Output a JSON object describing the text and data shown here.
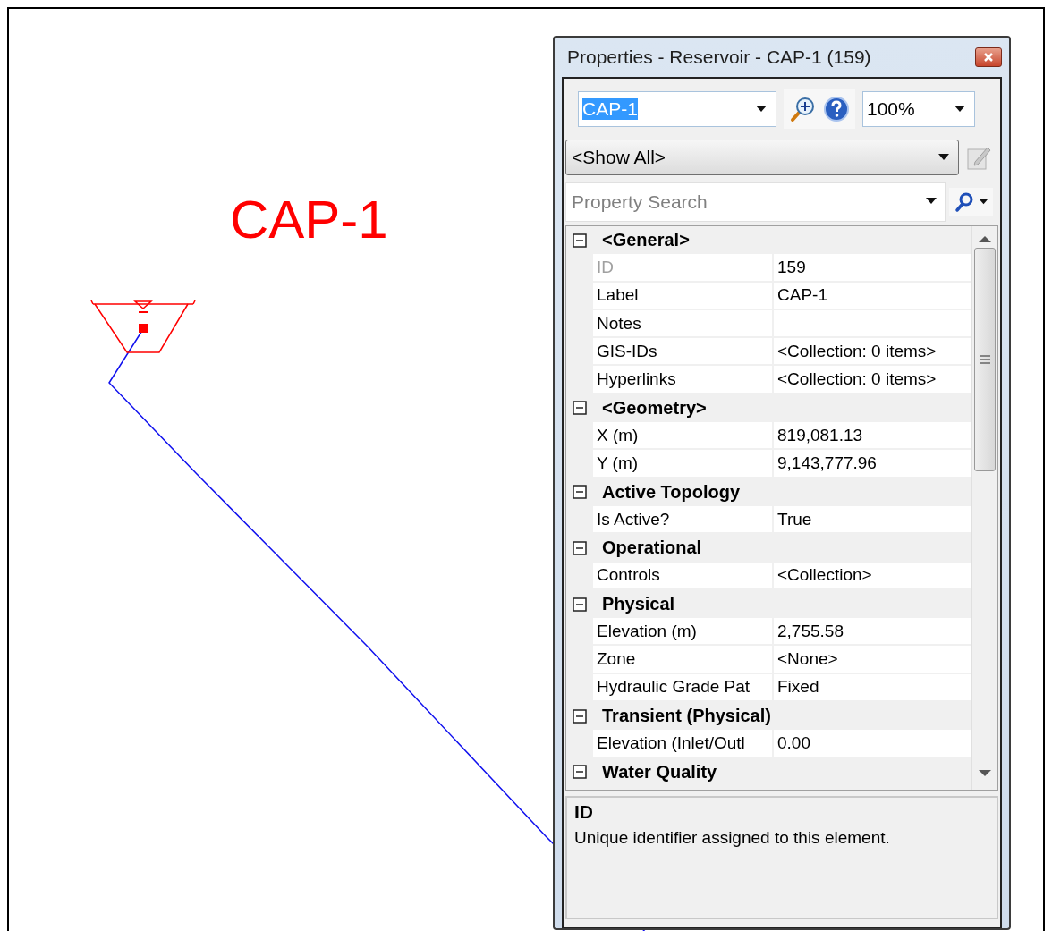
{
  "canvas": {
    "element_label": "CAP-1"
  },
  "window": {
    "title": "Properties - Reservoir - CAP-1 (159)"
  },
  "toolbar": {
    "element_selector": {
      "value": "CAP-1",
      "text_highlighted": true
    },
    "zoom_selector": {
      "value": "100%"
    }
  },
  "filter": {
    "value": "<Show All>"
  },
  "search": {
    "placeholder": "Property Search"
  },
  "grid": {
    "categories": [
      {
        "name": "<General>",
        "expanded": true,
        "properties": [
          {
            "name": "ID",
            "value": "159",
            "disabled": true
          },
          {
            "name": "Label",
            "value": "CAP-1",
            "disabled": false
          },
          {
            "name": "Notes",
            "disabled": false
          },
          {
            "name": "GIS-IDs",
            "value": "<Collection: 0 items>",
            "disabled": false
          },
          {
            "name": "Hyperlinks",
            "value": "<Collection: 0 items>",
            "disabled": false
          }
        ]
      },
      {
        "name": "<Geometry>",
        "expanded": true,
        "properties": [
          {
            "name": "X (m)",
            "value": "819,081.13",
            "disabled": false
          },
          {
            "name": "Y (m)",
            "value": "9,143,777.96",
            "disabled": false
          }
        ]
      },
      {
        "name": "Active Topology",
        "expanded": true,
        "properties": [
          {
            "name": "Is Active?",
            "value": "True",
            "disabled": false
          }
        ]
      },
      {
        "name": "Operational",
        "expanded": true,
        "properties": [
          {
            "name": "Controls",
            "value": "<Collection>",
            "disabled": false
          }
        ]
      },
      {
        "name": "Physical",
        "expanded": true,
        "properties": [
          {
            "name": "Elevation (m)",
            "value": "2,755.58",
            "disabled": false
          },
          {
            "name": "Zone",
            "value": "<None>",
            "disabled": false
          },
          {
            "name": "Hydraulic Grade Pat",
            "value": "Fixed",
            "disabled": false
          }
        ]
      },
      {
        "name": "Transient (Physical)",
        "expanded": true,
        "properties": [
          {
            "name": "Elevation (Inlet/Outl",
            "value": "0.00",
            "disabled": false
          }
        ]
      },
      {
        "name": "Water Quality",
        "expanded": true
      }
    ]
  },
  "description": {
    "title": "ID",
    "text": "Unique identifier assigned to this element."
  }
}
